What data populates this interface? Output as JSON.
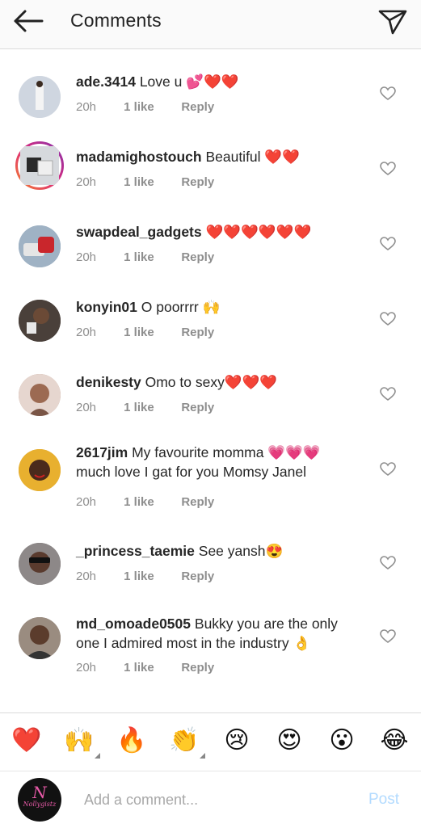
{
  "header": {
    "title": "Comments",
    "back_icon": "arrow-left-icon",
    "share_icon": "paper-plane-icon"
  },
  "comments": [
    {
      "username": "ade.3414",
      "body": "Love u 💕❤️❤️",
      "time": "20h",
      "likes": "1 like",
      "reply": "Reply",
      "avatar_color": "#d9dce4"
    },
    {
      "username": "madamighostouch",
      "body": "Beautiful ❤️❤️",
      "time": "20h",
      "likes": "1 like",
      "reply": "Reply",
      "avatar_color": "#cfd3d8",
      "story_ring": true
    },
    {
      "username": "swapdeal_gadgets",
      "body": "❤️❤️❤️❤️❤️❤️",
      "time": "20h",
      "likes": "1 like",
      "reply": "Reply",
      "avatar_color": "#8fa3b8"
    },
    {
      "username": "konyin01",
      "body": "O poorrrr 🙌",
      "time": "20h",
      "likes": "1 like",
      "reply": "Reply",
      "avatar_color": "#3a3532"
    },
    {
      "username": "denikesty",
      "body": "Omo to sexy❤️❤️❤️",
      "time": "20h",
      "likes": "1 like",
      "reply": "Reply",
      "avatar_color": "#b58b78"
    },
    {
      "username": "2617jim",
      "body": "My favourite momma 💗💗💗 much love I gat for you Momsy Janel",
      "time": "20h",
      "likes": "1 like",
      "reply": "Reply",
      "avatar_color": "#d4a02a"
    },
    {
      "username": "_princess_taemie",
      "body": "See yansh😍",
      "time": "20h",
      "likes": "1 like",
      "reply": "Reply",
      "avatar_color": "#6e6a6a"
    },
    {
      "username": "md_omoade0505",
      "body": "Bukky you are the only one I admired most in the industry 👌",
      "time": "20h",
      "likes": "1 like",
      "reply": "Reply",
      "avatar_color": "#7a6a5e"
    }
  ],
  "emoji_bar": [
    "❤️",
    "🙌",
    "🔥",
    "👏",
    "😢",
    "😍",
    "😮",
    "😂"
  ],
  "compose": {
    "placeholder": "Add a comment...",
    "post_label": "Post",
    "avatar_logo_big": "N",
    "avatar_logo_small": "Nollygistz"
  }
}
